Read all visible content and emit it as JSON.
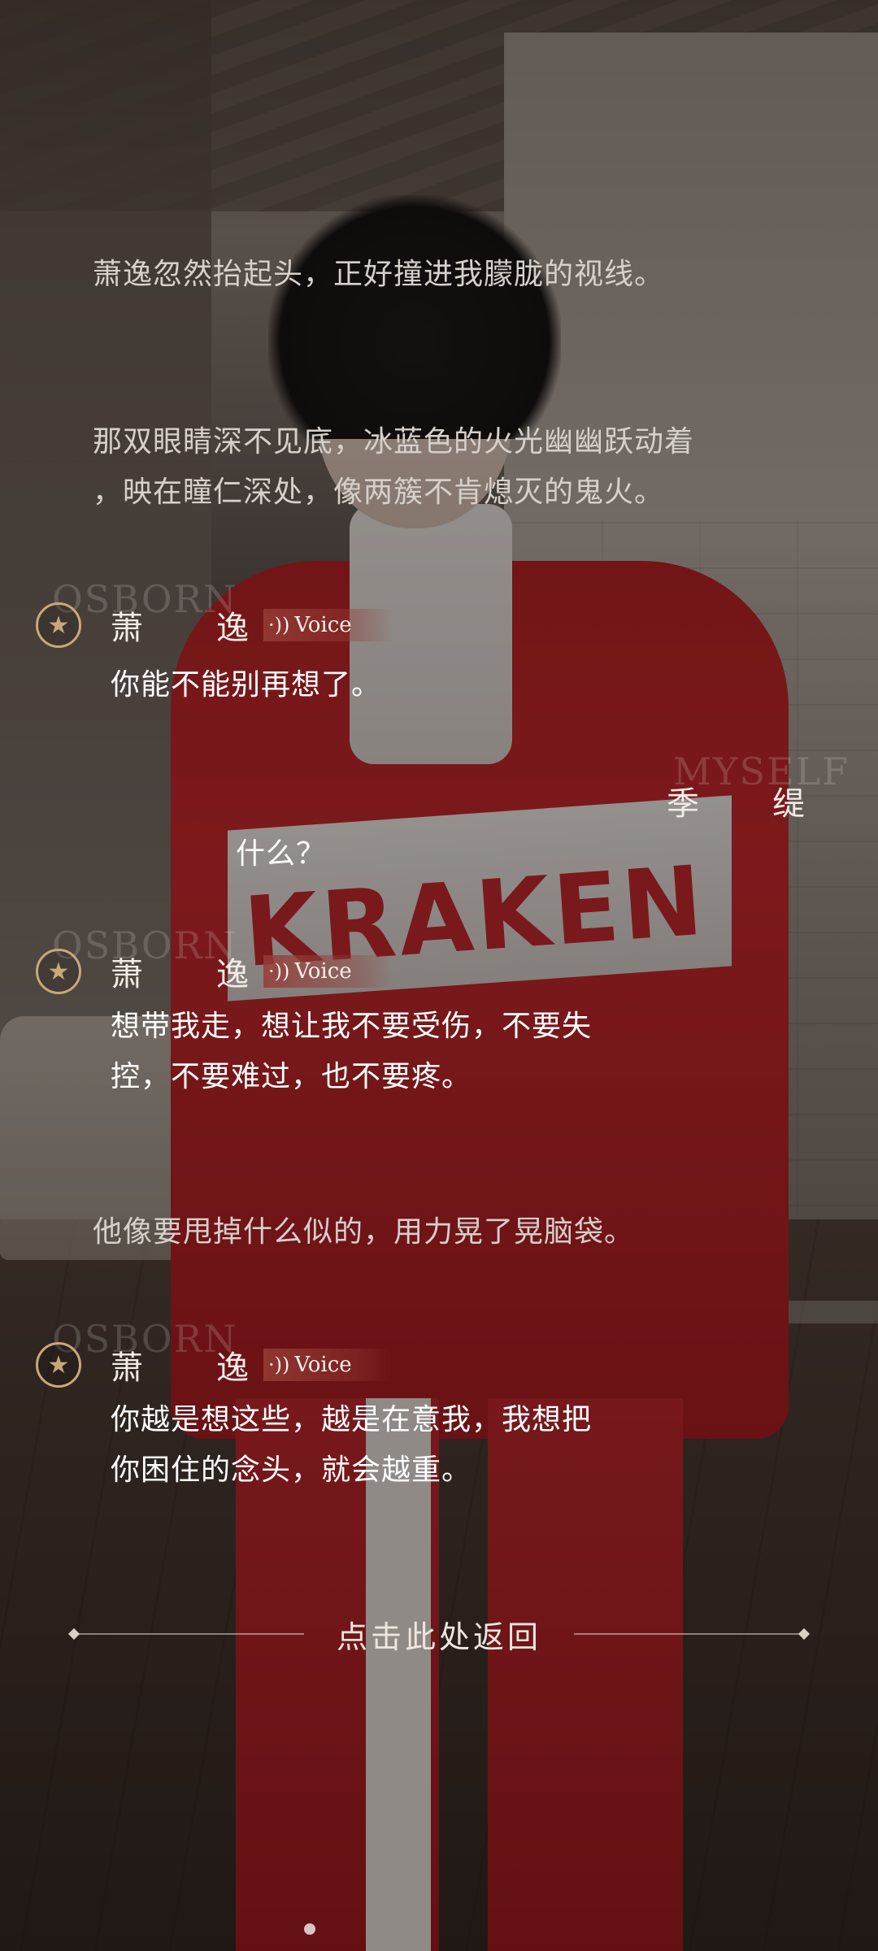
{
  "story": {
    "narration_1": "萧逸忽然抬起头，正好撞进我朦胧的视线。",
    "narration_2_line1": "那双眼睛深不见底，冰蓝色的火光幽幽跃动着",
    "narration_2_line2": "，映在瞳仁深处，像两簇不肯熄灭的鬼火。",
    "narration_3": "他像要甩掉什么似的，用力晃了晃脑袋。"
  },
  "speaker": {
    "name_char1": "萧",
    "name_char2": "逸",
    "voice_label": "Voice",
    "watermark": "OSBORN"
  },
  "player": {
    "name_char1": "季",
    "name_char2": "缇",
    "watermark": "MYSELF"
  },
  "dialogs": {
    "d1_line1": "你能不能别再想了。",
    "reply": "什么？",
    "d2_line1": "想带我走，想让我不要受伤，不要失",
    "d2_line2": "控，不要难过，也不要疼。",
    "d3_line1": "你越是想这些，越是在意我，我想把",
    "d3_line2": "你困住的念头，就会越重。"
  },
  "background_art_text": {
    "logo": "KRAKEN"
  },
  "controls": {
    "back_label": "点击此处返回"
  },
  "icons": {
    "star_badge": "star-icon",
    "voice": "voice-wave-icon"
  },
  "colors": {
    "accent_gold": "#c9a878",
    "voice_tag": "#963c37",
    "suit_red": "#c8242a"
  }
}
